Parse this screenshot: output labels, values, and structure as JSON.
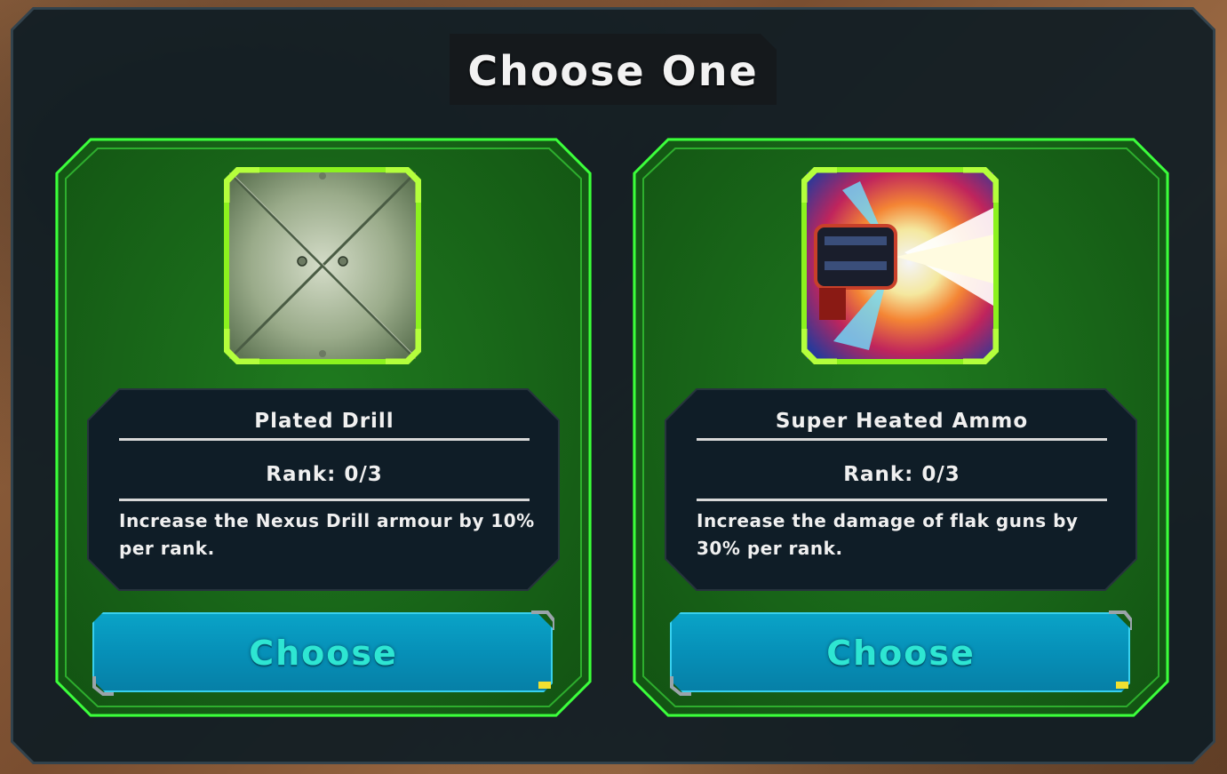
{
  "dialog": {
    "title": "Choose One"
  },
  "options": [
    {
      "name": "Plated Drill",
      "rank": "Rank: 0/3",
      "description": "Increase the Nexus Drill armour by 10% per rank.",
      "icon": "armor-plate-icon",
      "button_label": "Choose"
    },
    {
      "name": "Super Heated Ammo",
      "rank": "Rank: 0/3",
      "description": "Increase the damage of flak guns by 30% per rank.",
      "icon": "flame-cannon-icon",
      "button_label": "Choose"
    }
  ],
  "colors": {
    "card_green": "#1b6e1b",
    "card_border": "#3cff3c",
    "icon_frame": "#8cf21e",
    "button_fill": "#0690b8",
    "button_text": "#2ee6d2",
    "panel_dark": "#0f1d27"
  }
}
